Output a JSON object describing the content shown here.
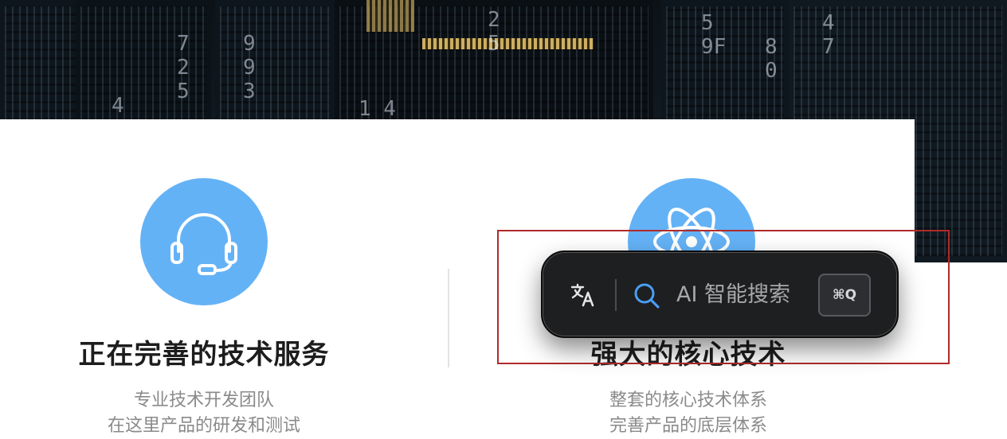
{
  "hero": {
    "digit_columns": [
      "7\n2\n5",
      "9\n9\n3",
      "5\n8",
      "2\n5",
      "5\n9F",
      "8\n0",
      "4\n7",
      "4",
      "1 4"
    ]
  },
  "features": [
    {
      "icon": "headset-icon",
      "title": "正在完善的技术服务",
      "desc_lines": [
        "专业技术开发团队",
        "在这里产品的研发和测试"
      ]
    },
    {
      "icon": "atom-icon",
      "title": "强大的核心技术",
      "desc_lines": [
        "整套的核心技术体系",
        "完善产品的底层体系"
      ]
    }
  ],
  "search_bar": {
    "translate_icon": "translate-icon",
    "search_icon": "search-icon",
    "placeholder": "AI 智能搜索",
    "shortcut": "⌘Q"
  },
  "colors": {
    "icon_circle": "#64b2f6",
    "pill_bg": "#1e1f21",
    "highlight_border": "#b02a2a",
    "search_accent": "#4a9ef5"
  }
}
